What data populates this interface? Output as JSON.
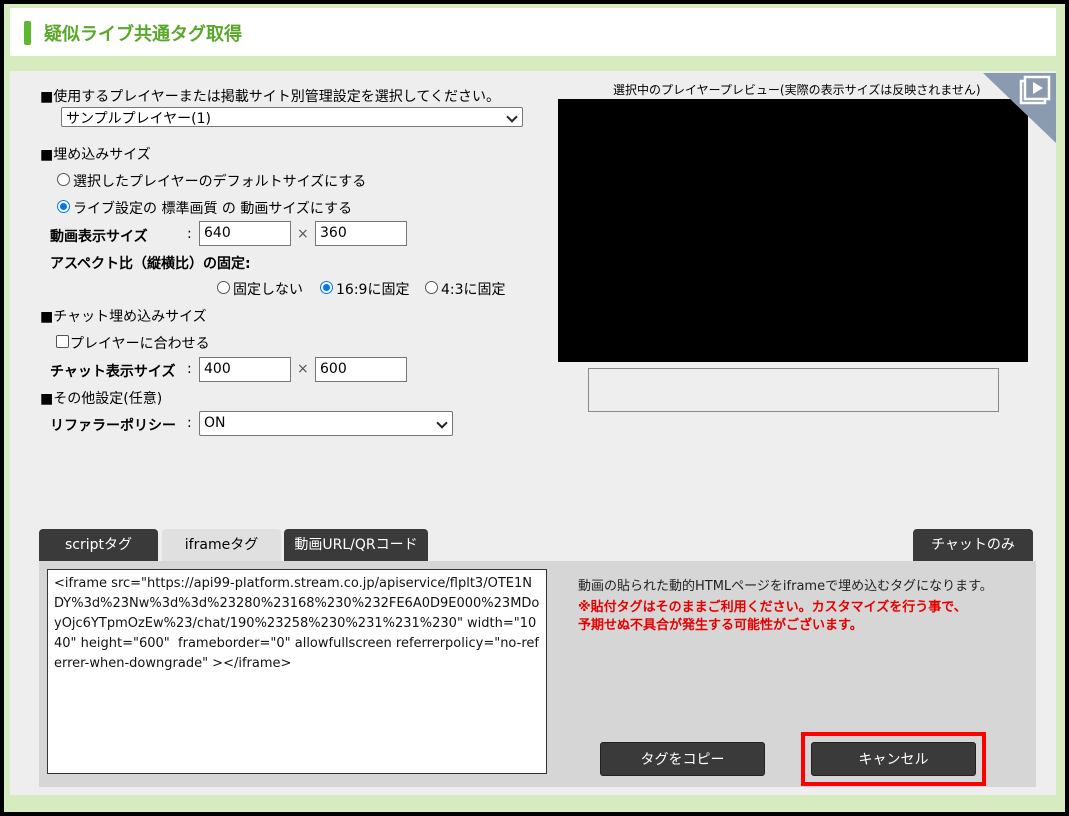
{
  "header": {
    "title": "疑似ライブ共通タグ取得"
  },
  "player_section": {
    "heading": "■使用するプレイヤーまたは掲載サイト別管理設定を選択してください。",
    "selected": "サンプルプレイヤー(1)"
  },
  "embed_size": {
    "heading": "■埋め込みサイズ",
    "option_default": "選択したプレイヤーのデフォルトサイズにする",
    "option_live": "ライブ設定の 標準画質 の 動画サイズにする",
    "video_size_label": "動画表示サイズ",
    "colon": ":",
    "width": "640",
    "height": "360",
    "times": "×",
    "aspect_label": "アスペクト比（縦横比）の固定:",
    "aspect_none": "固定しない",
    "aspect_169": "16:9に固定",
    "aspect_43": "4:3に固定"
  },
  "chat_size": {
    "heading": "■チャット埋め込みサイズ",
    "fit_player": "プレイヤーに合わせる",
    "label": "チャット表示サイズ",
    "width": "400",
    "height": "600"
  },
  "other": {
    "heading": "■その他設定(任意)",
    "referrer_label": "リファラーポリシー",
    "referrer_value": "ON"
  },
  "preview": {
    "caption": "選択中のプレイヤープレビュー(実際の表示サイズは反映されません)"
  },
  "tabs": [
    {
      "label": "scriptタグ"
    },
    {
      "label": "iframeタグ"
    },
    {
      "label": "動画URL/QRコード"
    },
    {
      "label": "チャットのみ"
    }
  ],
  "code": "<iframe src=\"https://api99-platform.stream.co.jp/apiservice/flplt3/OTE1NDY%3d%23Nw%3d%3d%23280%23168%230%232FE6A0D9E000%23MDoyOjc6YTpmOzEw%23/chat/190%23258%230%231%231%230\" width=\"1040\" height=\"600\"  frameborder=\"0\" allowfullscreen referrerpolicy=\"no-referrer-when-downgrade\" ></iframe>",
  "description": "動画の貼られた動的HTMLページをiframeで埋め込むタグになります。",
  "warning_line1": "※貼付タグはそのままご利用ください。カスタマイズを行う事で、",
  "warning_line2": "予期せぬ不具合が発生する可能性がございます。",
  "buttons": {
    "copy": "タグをコピー",
    "cancel": "キャンセル"
  },
  "colors": {
    "accent": "#5cb82e",
    "warning": "#e60000",
    "highlight": "#ff0000"
  }
}
